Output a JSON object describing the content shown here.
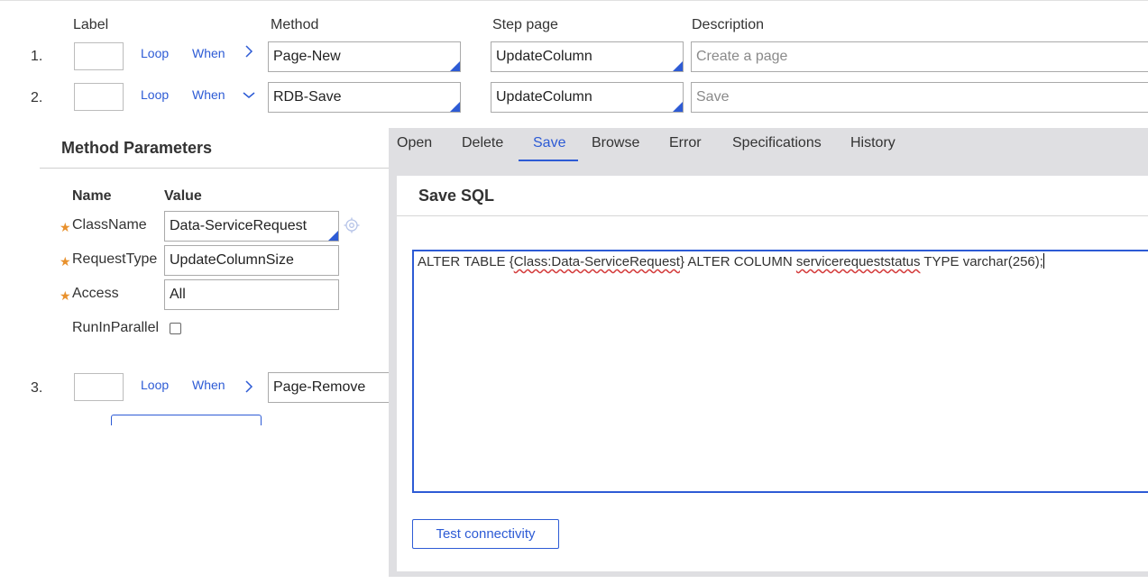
{
  "headers": {
    "label": "Label",
    "method": "Method",
    "step_page": "Step page",
    "description": "Description"
  },
  "steps": [
    {
      "num": "1.",
      "loop": "Loop",
      "when": "When",
      "method": "Page-New",
      "step_page": "UpdateColumn",
      "description_placeholder": "Create a page"
    },
    {
      "num": "2.",
      "loop": "Loop",
      "when": "When",
      "method": "RDB-Save",
      "step_page": "UpdateColumn",
      "description_placeholder": "Save"
    },
    {
      "num": "3.",
      "loop": "Loop",
      "when": "When",
      "method": "Page-Remove"
    }
  ],
  "method_parameters": {
    "title": "Method Parameters",
    "col_name": "Name",
    "col_value": "Value",
    "params": [
      {
        "name": "ClassName",
        "value": "Data-ServiceRequest",
        "required": true
      },
      {
        "name": "RequestType",
        "value": "UpdateColumnSize",
        "required": true
      },
      {
        "name": "Access",
        "value": "All",
        "required": true
      },
      {
        "name": "RunInParallel",
        "checked": false,
        "required": false
      }
    ]
  },
  "panel": {
    "tabs": [
      "Open",
      "Delete",
      "Save",
      "Browse",
      "Error",
      "Specifications",
      "History"
    ],
    "active_tab": "Save",
    "section_title": "Save SQL",
    "sql": {
      "part1": "ALTER TABLE {",
      "part2": "Class:Data-ServiceRequest",
      "part3": "} ALTER COLUMN ",
      "part4": "servicerequeststatus",
      "part5": " TYPE varchar(256);"
    },
    "test_button": "Test connectivity"
  },
  "colors": {
    "accent": "#2d5bd5",
    "required_star": "#e8912d",
    "panel_bg": "#dfdfe2"
  }
}
